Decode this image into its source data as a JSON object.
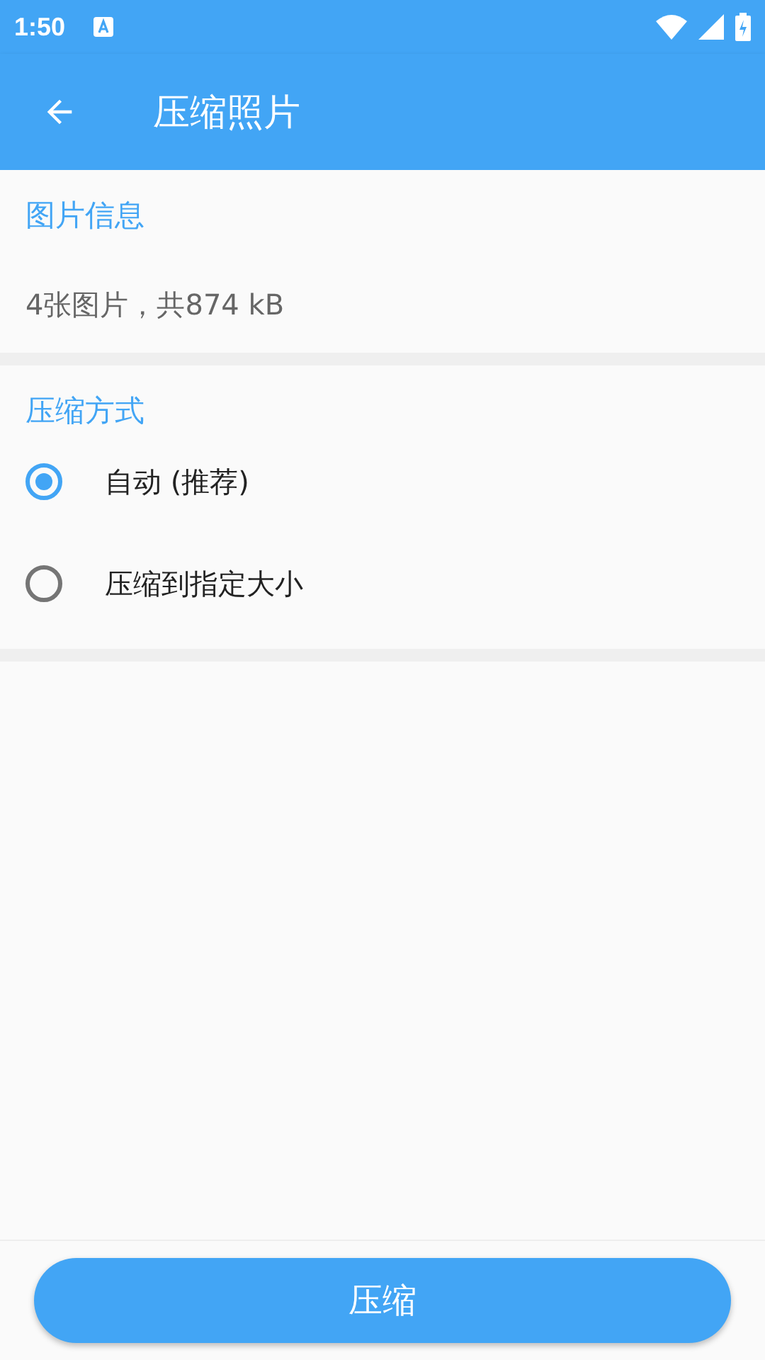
{
  "status_bar": {
    "time": "1:50"
  },
  "toolbar": {
    "title": "压缩照片"
  },
  "info": {
    "title": "图片信息",
    "text": "4张图片，共874 kB"
  },
  "compression": {
    "title": "压缩方式",
    "options": [
      {
        "label": "自动 (推荐)",
        "selected": true
      },
      {
        "label": "压缩到指定大小",
        "selected": false
      }
    ]
  },
  "action_button": {
    "label": "压缩"
  }
}
